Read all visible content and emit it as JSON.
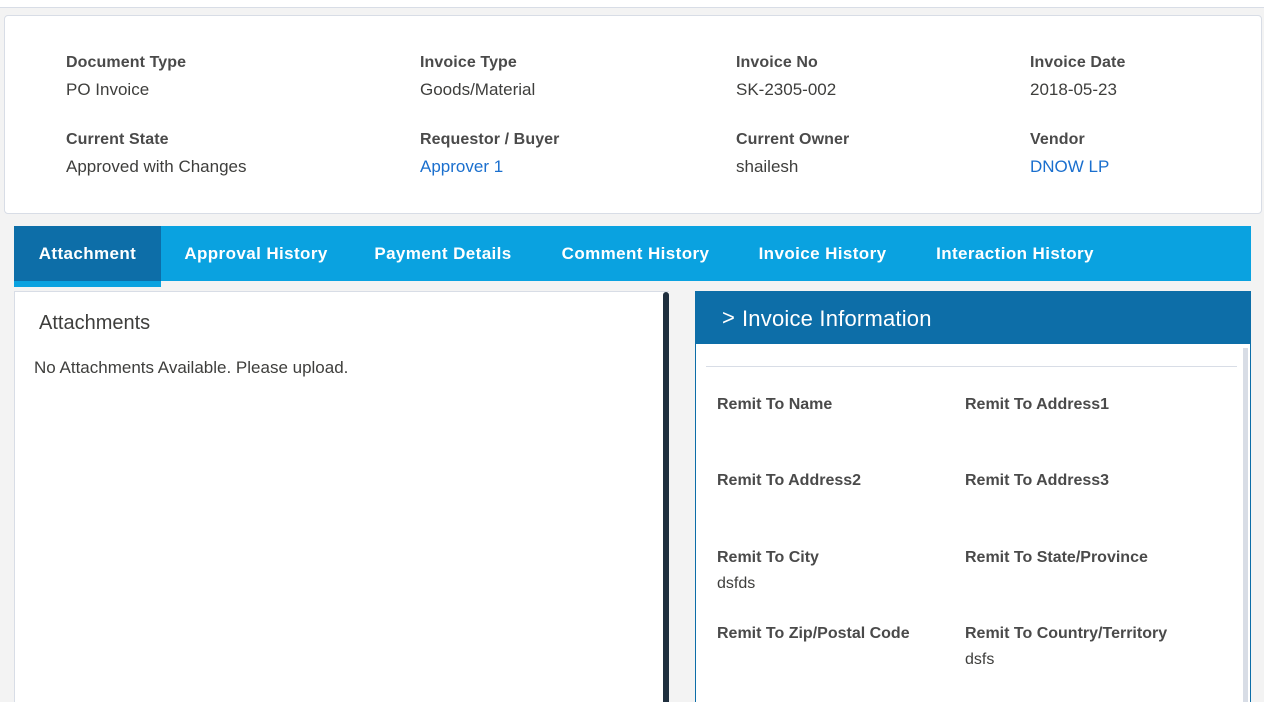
{
  "header": {
    "fields": [
      {
        "label": "Document Type",
        "value": "PO Invoice"
      },
      {
        "label": "Invoice Type",
        "value": "Goods/Material"
      },
      {
        "label": "Invoice No",
        "value": "SK-2305-002"
      },
      {
        "label": "Invoice Date",
        "value": "2018-05-23"
      },
      {
        "label": "Current State",
        "value": "Approved with Changes"
      },
      {
        "label": "Requestor / Buyer",
        "value": "Approver 1"
      },
      {
        "label": "Current Owner",
        "value": "shailesh"
      },
      {
        "label": "Vendor",
        "value": "DNOW LP"
      }
    ]
  },
  "tabs": [
    {
      "label": "Attachment"
    },
    {
      "label": "Approval History"
    },
    {
      "label": "Payment Details"
    },
    {
      "label": "Comment History"
    },
    {
      "label": "Invoice History"
    },
    {
      "label": "Interaction History"
    }
  ],
  "attachments": {
    "title": "Attachments",
    "empty_message": "No Attachments Available. Please upload."
  },
  "invoice_info": {
    "title": "Invoice Information",
    "chevron": ">",
    "fields": [
      {
        "label": "Remit To Name",
        "value": ""
      },
      {
        "label": "Remit To Address1",
        "value": ""
      },
      {
        "label": "Remit To Address2",
        "value": ""
      },
      {
        "label": "Remit To Address3",
        "value": ""
      },
      {
        "label": "Remit To City",
        "value": "dsfds"
      },
      {
        "label": "Remit To State/Province",
        "value": ""
      },
      {
        "label": "Remit To Zip/Postal Code",
        "value": ""
      },
      {
        "label": "Remit To Country/Territory",
        "value": "dsfs"
      }
    ]
  },
  "colors": {
    "tab_bar": "#0aa2e0",
    "tab_active": "#0d6ea8",
    "link": "#1a6fce",
    "panel_header": "#0d6ea8"
  }
}
